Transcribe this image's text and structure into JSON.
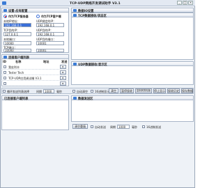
{
  "window": {
    "title": "TCP-UDP网络开发调试助手 V3.1"
  },
  "title_buttons": [
    "_",
    "□",
    "×"
  ],
  "config": {
    "header": "设置-应有配置",
    "server_radio": "作为TCP服务器",
    "client_radio": "作为TCP客户端",
    "udp_radio": "UDP",
    "local_ip_label": "本地IP地址：",
    "local_ip": "192.168.0.1",
    "udp_local_ip_label": "UDP绑定的IP：",
    "tcp_target_ip_label": "TCP目的IP：",
    "tcp_target_ip": "127.0.0.1",
    "udp_target_ip_label": "UDP目的IP：",
    "udp_target_ip": "192.168.0.1",
    "local_port_label": "本地端口：",
    "local_port": "10000",
    "udp_target_port_label": "UDP目的端口：",
    "udp_target_port": "10001",
    "tcp_port_label": "TCP端口：",
    "tcp_port": "10000",
    "udp_port": "10001"
  },
  "tcp_panel": {
    "header": "TCP数据接收/状态区"
  },
  "udp_panel": {
    "header": "UDP数据接收/显示区"
  },
  "io_bar": {
    "header": "数据IO设置"
  },
  "client_list": {
    "header": "连接客户端列表",
    "col_id": "ID",
    "col_name": "名称",
    "col_addr": "地址",
    "col_action": "发送",
    "rows": [
      {
        "name": "我宏利丰"
      },
      {
        "name": "Tester Tech"
      },
      {
        "name": "TCP-UDP应用调试端 V3.1"
      },
      {
        "name": ""
      }
    ]
  },
  "toolbar": {
    "loop_label": "循环发送列表选择",
    "interval_label": "间隔",
    "interval_value": "1000",
    "ms_label": "毫秒",
    "auto_clear_label": "自动清空",
    "hex_display_label": "16进制显示",
    "clear_btn": "清空",
    "stop_btn": "暂停接收",
    "copy_btn": "复制到剪贴板",
    "save_btn": "保存数据",
    "pause_btn": "停止显示",
    "log_btn": "接收历史"
  },
  "send_area": {
    "left_header": "已连接客户端列表",
    "right_header": "数据发送区",
    "send_btn": "清空重填",
    "auto_send_label": "自动发送",
    "period_label": "周期",
    "period_value": "1000",
    "ms_label": "毫秒",
    "hex_send_label": "16进制发送"
  },
  "colors": {
    "accent": "#3a6fd8",
    "panel": "#ffffff",
    "bg": "#eef2f7"
  }
}
